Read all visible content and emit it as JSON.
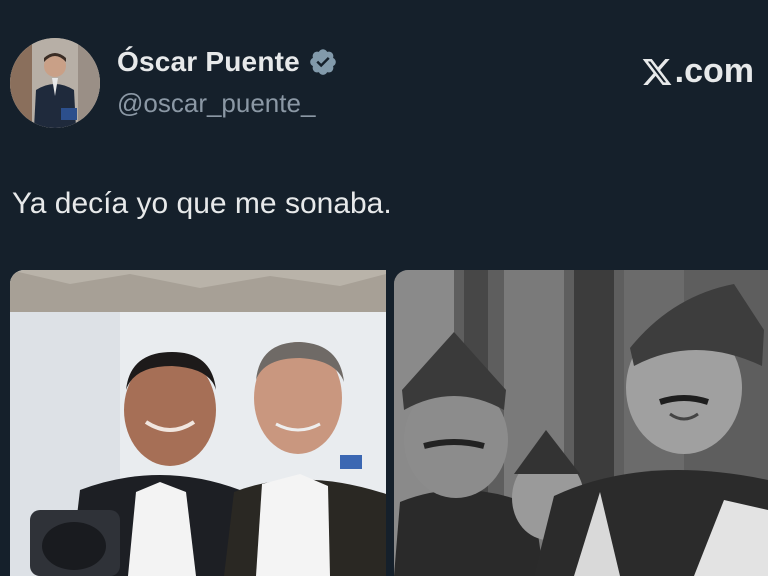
{
  "author": {
    "display_name": "Óscar Puente",
    "handle": "@oscar_puente_",
    "verified_icon": "verified-badge-icon"
  },
  "brand": {
    "label": ".com",
    "icon": "x-logo-icon"
  },
  "tweet": {
    "text": "Ya decía yo que me sonaba."
  },
  "media": {
    "left_photo": "two-men-smiling-photo",
    "right_photo": "black-and-white-archive-photo"
  },
  "colors": {
    "background": "#15202b",
    "text": "#e7e9ea",
    "secondary_text": "#8b98a5",
    "verified": "#829aab"
  }
}
